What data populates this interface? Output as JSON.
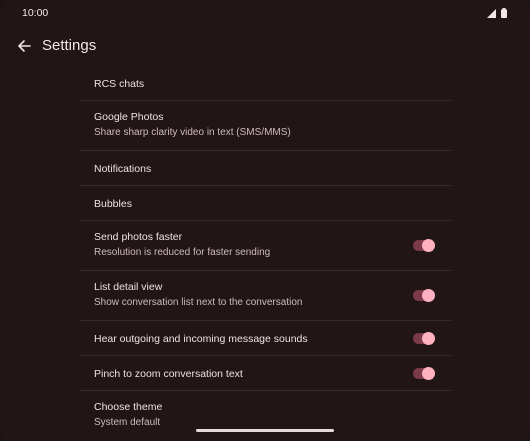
{
  "status": {
    "time": "10:00"
  },
  "header": {
    "title": "Settings"
  },
  "items": [
    {
      "title": "RCS chats"
    },
    {
      "title": "Google Photos",
      "subtitle": "Share sharp clarity video in text (SMS/MMS)"
    },
    {
      "title": "Notifications"
    },
    {
      "title": "Bubbles"
    },
    {
      "title": "Send photos faster",
      "subtitle": "Resolution is reduced for faster sending",
      "toggle": true
    },
    {
      "title": "List detail view",
      "subtitle": "Show conversation list next to the conversation",
      "toggle": true
    },
    {
      "title": "Hear outgoing and incoming message sounds",
      "toggle": true
    },
    {
      "title": "Pinch to zoom conversation text",
      "toggle": true
    },
    {
      "title": "Choose theme",
      "subtitle": "System default"
    }
  ],
  "colors": {
    "background": "#211515",
    "accent_thumb": "#ffb1c2",
    "accent_track": "#7a3a49"
  }
}
